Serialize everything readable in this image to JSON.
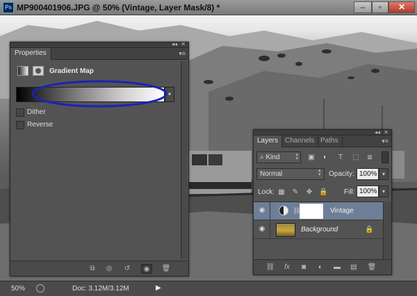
{
  "window": {
    "app_logo": "Ps",
    "title": "MP900401906.JPG @ 50% (Vintage, Layer Mask/8) *",
    "buttons": {
      "minimize": "–",
      "restore": "▫",
      "close": "✕"
    }
  },
  "properties_panel": {
    "tab": "Properties",
    "adjustment_name": "Gradient Map",
    "gradient": {
      "from": "#000000",
      "to": "#ffffff"
    },
    "annotation_color": "#1a24b4",
    "options": [
      {
        "label": "Dither",
        "checked": false
      },
      {
        "label": "Reverse",
        "checked": false
      }
    ],
    "footer_icons": [
      "clip-to-layer-icon",
      "view-previous-icon",
      "reset-icon",
      "visibility-icon",
      "delete-icon"
    ]
  },
  "layers_panel": {
    "tabs": [
      "Layers",
      "Channels",
      "Paths"
    ],
    "active_tab": "Layers",
    "filter": {
      "kind_label": "Kind"
    },
    "blend_mode": "Normal",
    "opacity_label": "Opacity:",
    "opacity_value": "100%",
    "lock_label": "Lock:",
    "fill_label": "Fill:",
    "fill_value": "100%",
    "layers": [
      {
        "name": "Vintage",
        "selected": true,
        "visible": true,
        "type": "gradient-map-adjustment"
      },
      {
        "name": "Background",
        "selected": false,
        "visible": true,
        "type": "image",
        "locked": true
      }
    ],
    "footer_icons": [
      "link-icon",
      "fx-icon",
      "mask-icon",
      "adjustment-icon",
      "group-icon",
      "new-layer-icon",
      "delete-icon"
    ]
  },
  "status_bar": {
    "zoom": "50%",
    "doc_info": "Doc: 3.12M/3.12M"
  }
}
